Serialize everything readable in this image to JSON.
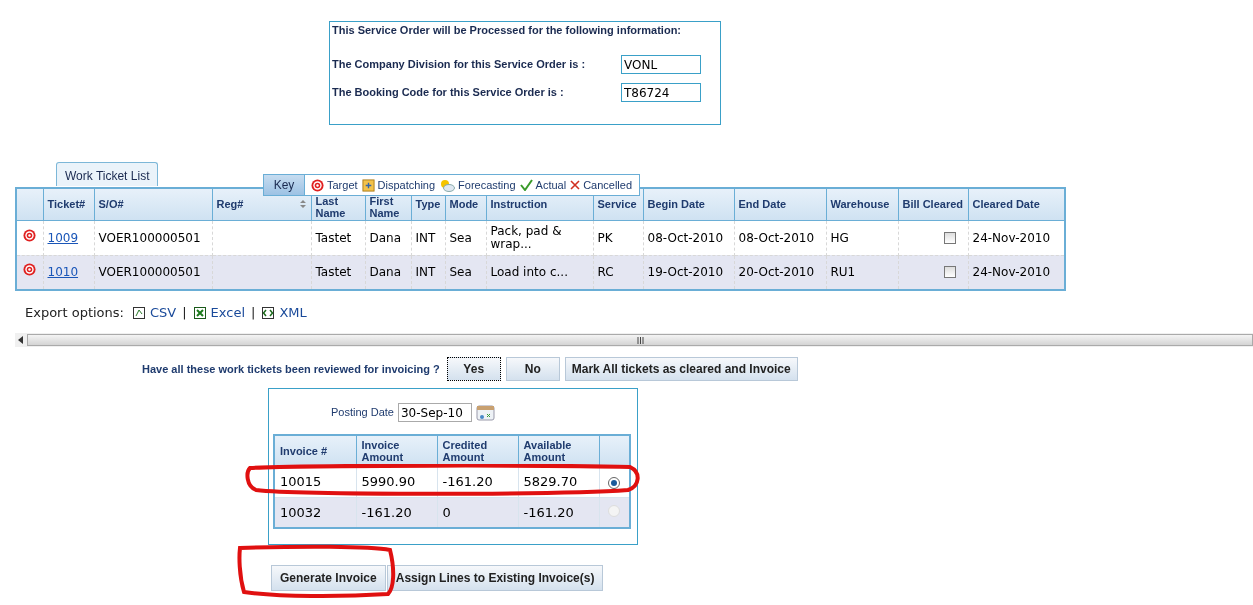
{
  "service_order": {
    "heading": "This Service Order will be Processed for the following information:",
    "fields": [
      {
        "label": "The Company Division for this Service Order is :",
        "value": "VONL"
      },
      {
        "label": "The Booking Code for this Service Order is :",
        "value": "T86724"
      }
    ]
  },
  "tab": {
    "label": "Work Ticket List",
    "selected": true
  },
  "key": {
    "label": "Key",
    "items": [
      {
        "kind": "target",
        "label": "Target"
      },
      {
        "kind": "dispatching",
        "label": "Dispatching"
      },
      {
        "kind": "forecasting",
        "label": "Forecasting"
      },
      {
        "kind": "actual",
        "label": "Actual"
      },
      {
        "kind": "cancelled",
        "label": "Cancelled"
      }
    ]
  },
  "table": {
    "columns": [
      "Ticket#",
      "S/O#",
      "Reg#",
      "Last Name",
      "First Name",
      "Type",
      "Mode",
      "Instruction",
      "Service",
      "Begin Date",
      "End Date",
      "Warehouse",
      "Bill Cleared",
      "Cleared Date"
    ],
    "rows": [
      {
        "kind": "target",
        "ticket": "1009",
        "so": "VOER100000501",
        "reg": "",
        "last_name": "Tastet",
        "first_name": "Dana",
        "type": "INT",
        "mode": "Sea",
        "instruction": "Pack, pad & wrap...",
        "service": "PK",
        "begin": "08-Oct-2010",
        "end": "08-Oct-2010",
        "warehouse": "HG",
        "bill_cleared": false,
        "cleared_date": "24-Nov-2010"
      },
      {
        "kind": "target",
        "ticket": "1010",
        "so": "VOER100000501",
        "reg": "",
        "last_name": "Tastet",
        "first_name": "Dana",
        "type": "INT",
        "mode": "Sea",
        "instruction": "Load into c...",
        "service": "RC",
        "begin": "19-Oct-2010",
        "end": "20-Oct-2010",
        "warehouse": "RU1",
        "bill_cleared": false,
        "cleared_date": "24-Nov-2010"
      }
    ]
  },
  "export": {
    "label": "Export options:",
    "options": [
      "CSV",
      "Excel",
      "XML"
    ],
    "separator": "|"
  },
  "review": {
    "question": "Have all these work tickets been reviewed for invoicing ?",
    "buttons": [
      {
        "label": "Yes",
        "selected": true
      },
      {
        "label": "No",
        "selected": false
      },
      {
        "label": "Mark All tickets as cleared and Invoice",
        "selected": false
      }
    ]
  },
  "invoice_panel": {
    "posting_date_label": "Posting Date",
    "posting_date": "30-Sep-10",
    "columns": [
      "Invoice #",
      "Invoice Amount",
      "Credited Amount",
      "Available Amount"
    ],
    "rows": [
      {
        "invoice": "10015",
        "amount": "5990.90",
        "credited": "-161.20",
        "available": "5829.70",
        "selected": true,
        "disabled": false
      },
      {
        "invoice": "10032",
        "amount": "-161.20",
        "credited": "0",
        "available": "-161.20",
        "selected": false,
        "disabled": true
      }
    ]
  },
  "actions": [
    "Generate Invoice",
    "Assign Lines to Existing Invoice(s)"
  ]
}
